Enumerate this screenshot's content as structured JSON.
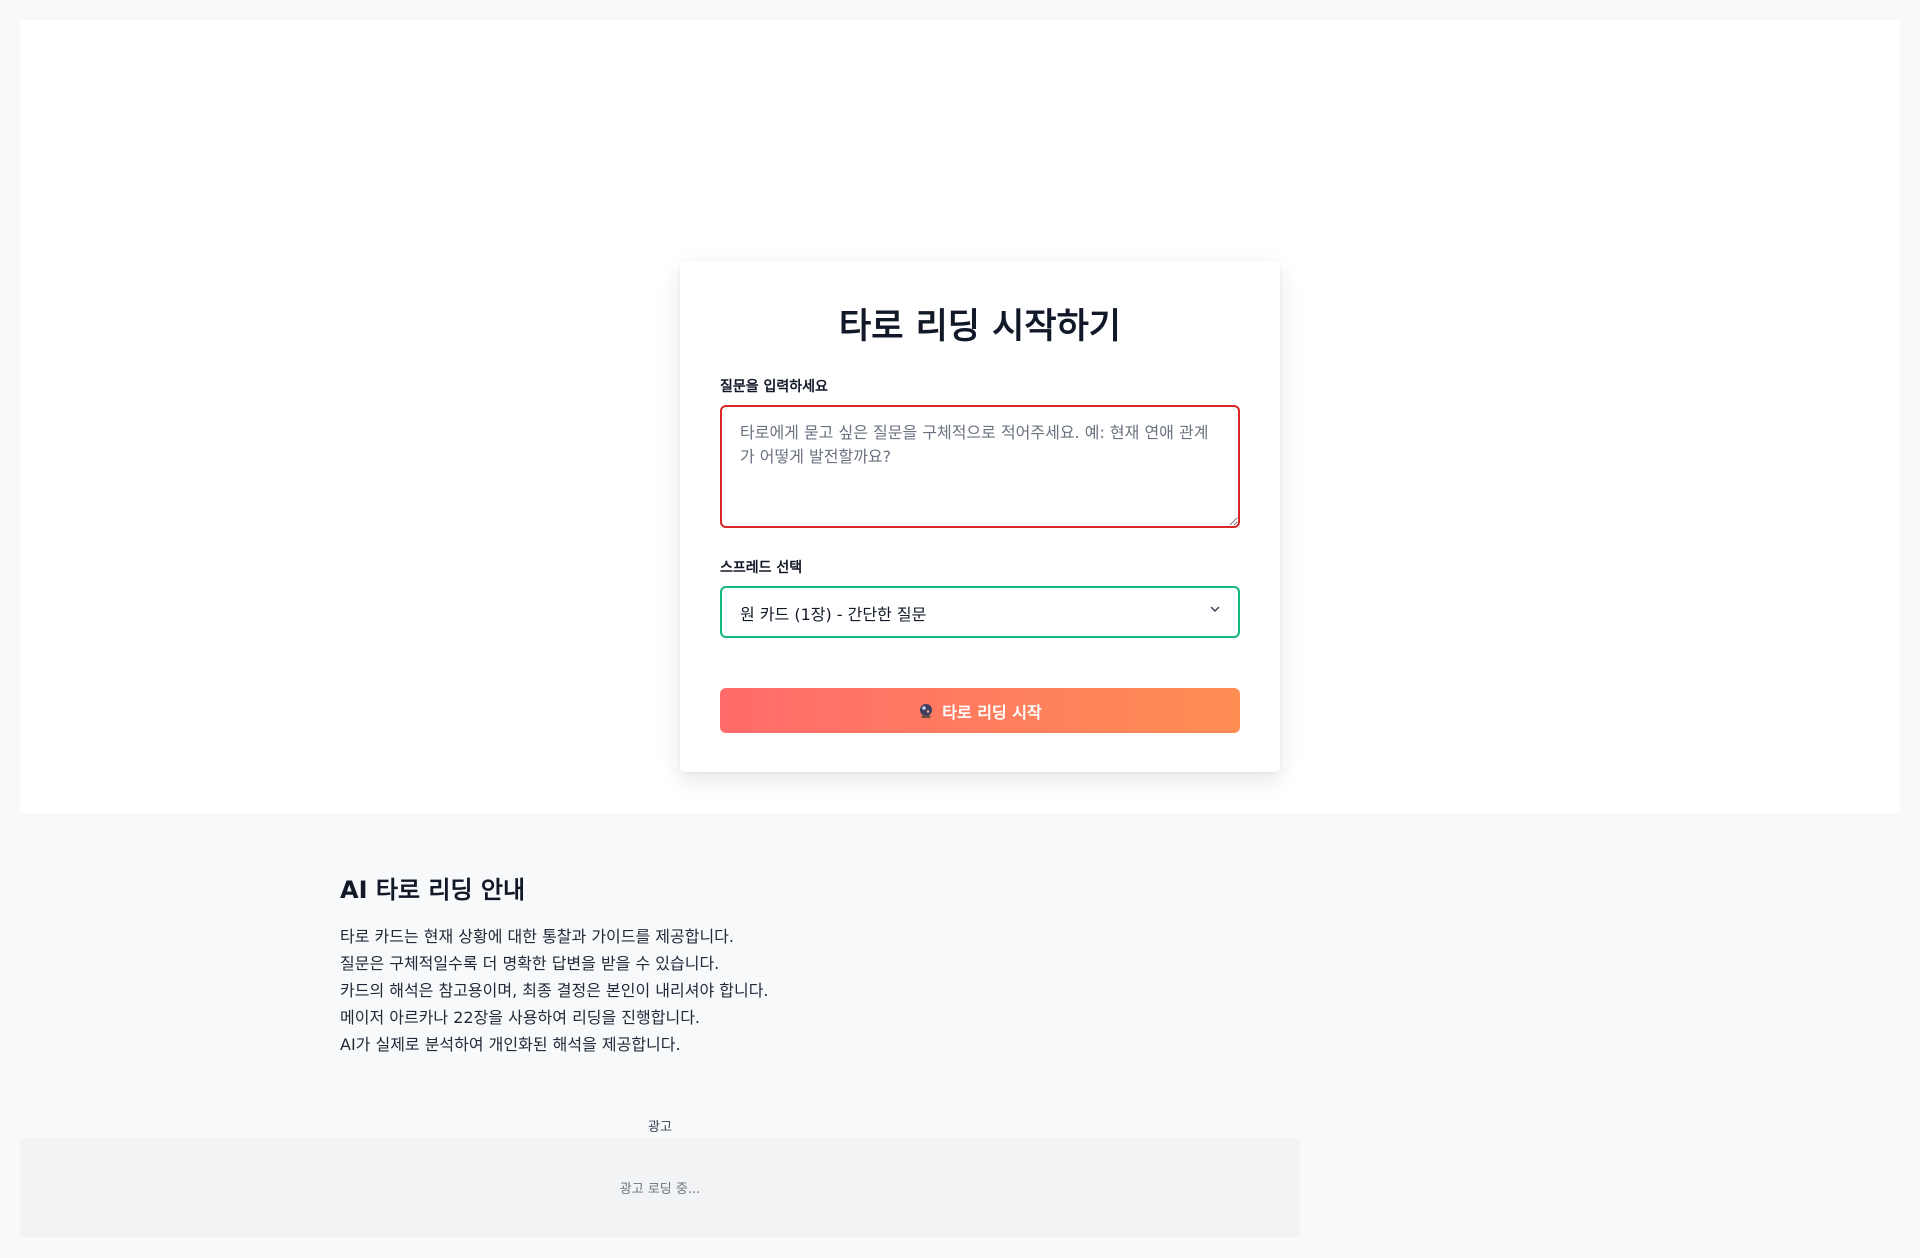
{
  "card": {
    "title": "타로 리딩 시작하기",
    "question_label": "질문을 입력하세요",
    "question_placeholder": "타로에게 묻고 싶은 질문을 구체적으로 적어주세요. 예: 현재 연애 관계가 어떻게 발전할까요?",
    "question_value": "",
    "spread_label": "스프레드 선택",
    "spread_selected": "원 카드 (1장) - 간단한 질문",
    "start_button_label": "타로 리딩 시작",
    "start_button_icon": "crystal-ball-icon"
  },
  "info": {
    "title": "AI 타로 리딩 안내",
    "lines": [
      "타로 카드는 현재 상황에 대한 통찰과 가이드를 제공합니다.",
      "질문은 구체적일수록 더 명확한 답변을 받을 수 있습니다.",
      "카드의 해석은 참고용이며, 최종 결정은 본인이 내리셔야 합니다.",
      "메이저 아르카나 22장을 사용하여 리딩을 진행합니다.",
      "AI가 실제로 분석하여 개인화된 해석을 제공합니다."
    ]
  },
  "ad": {
    "label": "광고",
    "loading_text": "광고 로딩 중..."
  },
  "colors": {
    "error_border": "#dc2626",
    "focus_border": "#10b981",
    "button_gradient_start": "#ff6b6b",
    "button_gradient_end": "#ff8e53"
  }
}
